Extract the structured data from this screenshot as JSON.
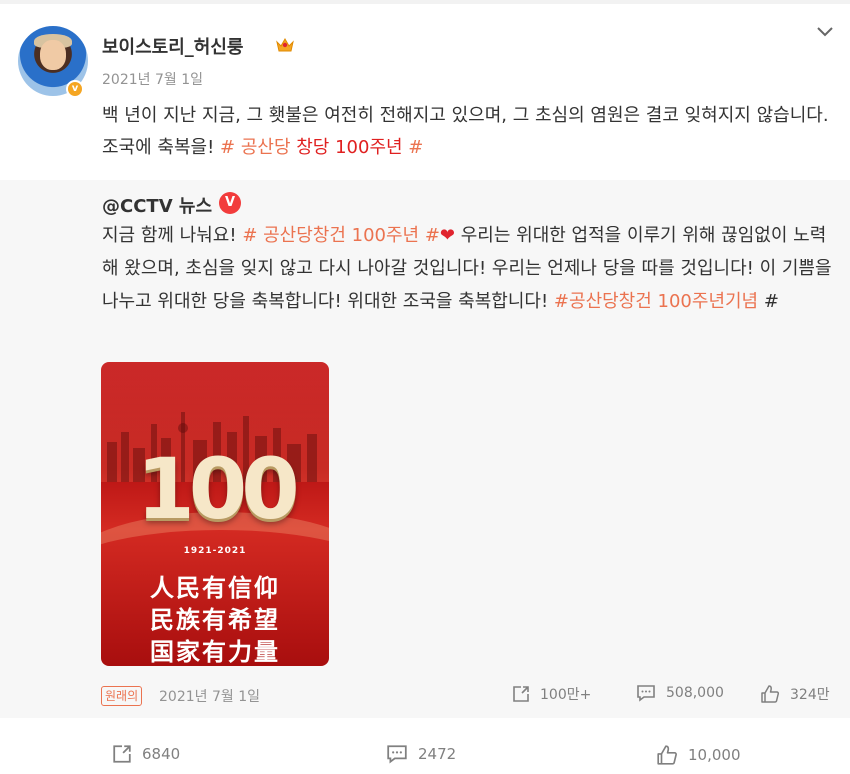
{
  "post": {
    "username": "보이스토리_허신룽",
    "date": "2021년 7월 1일",
    "text_main": "백 년이 지난 지금, 그 횃불은 여전히 전해지고 있으며, 그 초심의 염원은 결코 잊혀지지 않습니다. 조국에 축복을! ",
    "hashtag": "# 공산당 ",
    "hashtag_red": "창당 100주년",
    "hashtag_end": " #"
  },
  "repost": {
    "author": "@CCTV 뉴스",
    "verified_label": "V",
    "text_1": "지금 함께 나눠요! ",
    "tag_1": "# 공산당창건 100주년 #",
    "heart": "❤",
    "text_2": " 우리는 위대한 업적을 이루기 위해 끊임없이 노력해 왔으며, 초심을 잊지 않고 다시 나아갈 것입니다! 우리는 언제나 당을 따를 것입니다! 이 기쁨을 나누고 위대한 당을 축복합니다! 위대한 조국을 축복합니다! ",
    "tag_2": "#공산당창건 100주년기념",
    "tag_2_end": " #",
    "poster": {
      "number": "100",
      "years": "1921-2021",
      "line1": "人民有信仰",
      "line2": "民族有希望",
      "line3": "国家有力量"
    },
    "badge": "원래의",
    "date": "2021년 7월 1일",
    "shares": "100만+",
    "comments": "508,000",
    "likes": "324만"
  },
  "footer": {
    "shares": "6840",
    "comments": "2472",
    "likes": "10,000"
  },
  "colors": {
    "hashtag": "#eb7350",
    "hashtag_red": "#e02020",
    "repost_bg": "#f7f7f7",
    "muted": "#939393"
  },
  "icons": [
    "crown-icon",
    "chevron-down-icon",
    "verified-icon",
    "v-icon",
    "heart-icon",
    "share-icon",
    "comment-icon",
    "like-icon"
  ]
}
